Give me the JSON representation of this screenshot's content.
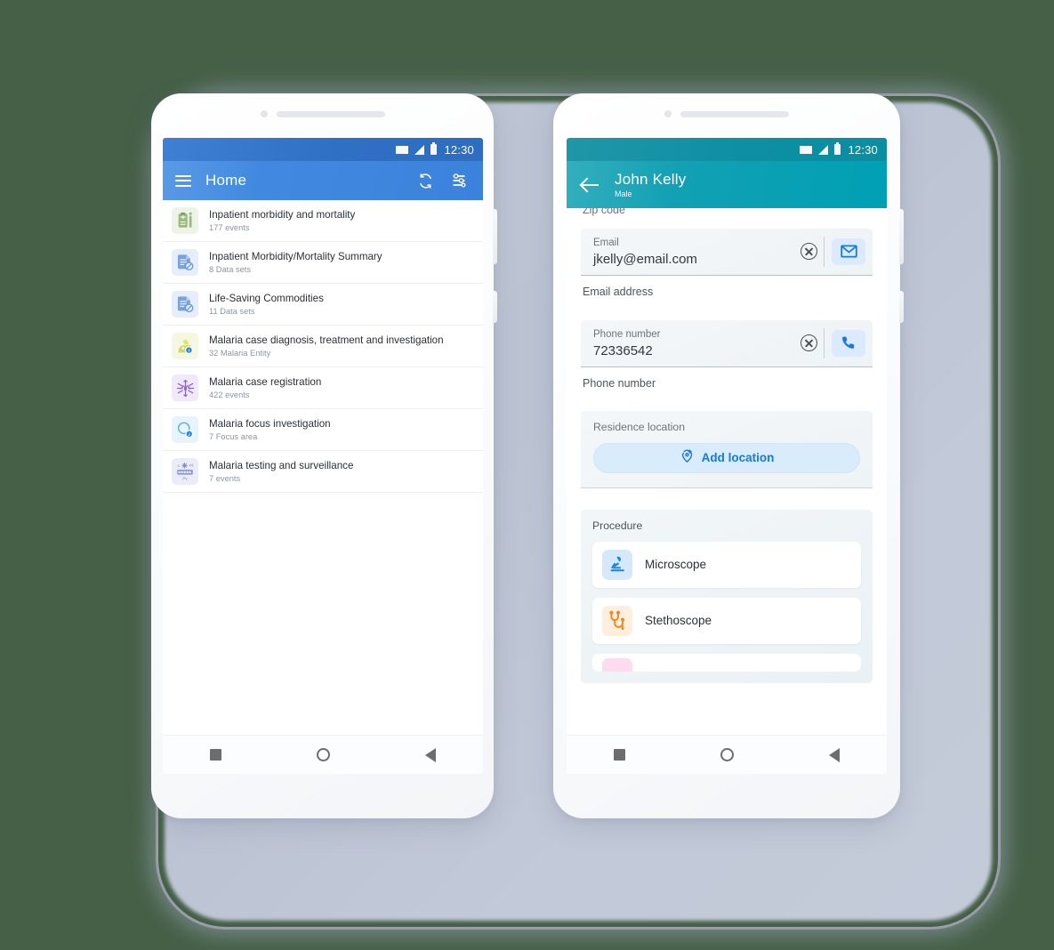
{
  "background": {
    "outer_color": "#466048",
    "ghost_color": "#c3cbdb"
  },
  "left_phone": {
    "status_bar": {
      "time": "12:30",
      "wifi": "wifi-icon",
      "signal": "signal-icon",
      "battery": "battery-icon",
      "bar_color": "#2f6fc4"
    },
    "app_bar": {
      "menu_label": "menu-icon",
      "title": "Home",
      "sync_label": "sync-icon",
      "filter_label": "tune-icon",
      "color": "#3b82dc"
    },
    "list": [
      {
        "title": "Inpatient morbidity and mortality",
        "subtitle": "177 events",
        "icon": "clipboard-icon",
        "icon_bg": "#eef3e8",
        "icon_color": "#8ba86d",
        "badge": ""
      },
      {
        "title": "Inpatient Morbidity/Mortality Summary",
        "subtitle": "8 Data sets",
        "icon": "dataset-icon",
        "icon_bg": "#e6eefb",
        "icon_color": "#6b96d6",
        "badge": ""
      },
      {
        "title": "Life-Saving Commodities",
        "subtitle": "11 Data sets",
        "icon": "dataset-icon",
        "icon_bg": "#e6eefb",
        "icon_color": "#6b96d6",
        "badge": ""
      },
      {
        "title": "Malaria case diagnosis, treatment and investigation",
        "subtitle": "32 Malaria Entity",
        "icon": "malaria-diagnosis-icon",
        "icon_bg": "#f5f7e2",
        "icon_color": "#c9d45f",
        "badge": "i"
      },
      {
        "title": "Malaria case registration",
        "subtitle": "422 events",
        "icon": "mosquito-icon",
        "icon_bg": "#efe9fa",
        "icon_color": "#8f62d8",
        "badge": ""
      },
      {
        "title": "Malaria focus investigation",
        "subtitle": "7 Focus area",
        "icon": "magnifier-icon",
        "icon_bg": "#e8f4fb",
        "icon_color": "#53b4e0",
        "badge": "i"
      },
      {
        "title": "Malaria testing and surveillance",
        "subtitle": "7 events",
        "icon": "test-strip-icon",
        "icon_bg": "#eaedf8",
        "icon_color": "#7d86c4",
        "badge": ""
      }
    ],
    "nav_bar": {
      "recent": "square-icon",
      "home": "circle-icon",
      "back": "triangle-back-icon"
    }
  },
  "right_phone": {
    "status_bar": {
      "time": "12:30",
      "wifi": "wifi-icon",
      "signal": "signal-icon",
      "battery": "battery-icon",
      "bar_color": "#0b8ea2"
    },
    "app_bar": {
      "back": "back-arrow-icon",
      "name": "John Kelly",
      "sub": "Male",
      "color": "#00a0b4"
    },
    "cut_off_label": "Zip code",
    "fields": [
      {
        "label": "Email",
        "value": "jkelly@email.com",
        "helper": "Email address",
        "clear": "clear-circle-icon",
        "action": "email-icon",
        "action_bg": "#dbeafe",
        "action_color": "#1878e0"
      },
      {
        "label": "Phone number",
        "value": "72336542",
        "helper": "Phone number",
        "clear": "clear-circle-icon",
        "action": "phone-icon",
        "action_bg": "#dbeafe",
        "action_color": "#1878e0"
      }
    ],
    "residence": {
      "label": "Residence location",
      "button_label": "Add location",
      "button_icon": "add-location-icon",
      "button_color": "#1878e0",
      "button_bg": "#d9ecfb"
    },
    "procedure": {
      "label": "Procedure",
      "items": [
        {
          "name": "Microscope",
          "icon": "microscope-icon",
          "icon_bg": "#d6e9fb",
          "icon_color": "#1a82e2"
        },
        {
          "name": "Stethoscope",
          "icon": "stethoscope-icon",
          "icon_bg": "#fdeedd",
          "icon_color": "#f2881b"
        },
        {
          "name": "",
          "icon": "pink-partial-icon",
          "icon_bg": "#fcdcee",
          "icon_color": "#ea2a93"
        }
      ]
    },
    "nav_bar": {
      "recent": "square-icon",
      "home": "circle-icon",
      "back": "triangle-back-icon"
    }
  }
}
